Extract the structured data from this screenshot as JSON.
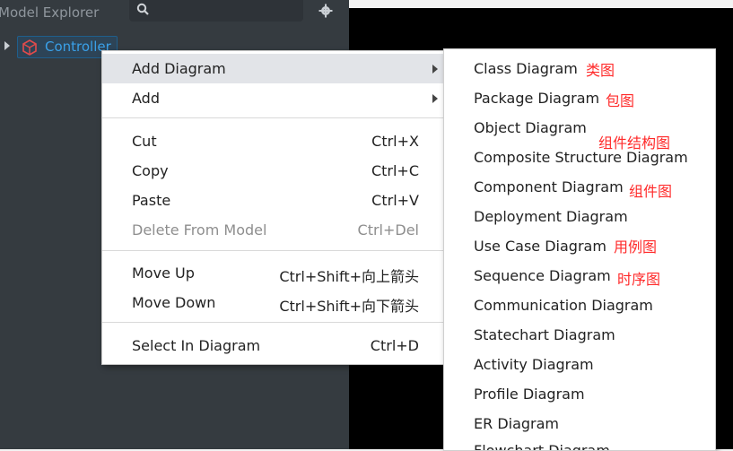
{
  "panel": {
    "title": "Model Explorer",
    "tree_node_label": "Controller"
  },
  "context_menu": {
    "items": [
      {
        "label": "Add Diagram",
        "shortcut": ""
      },
      {
        "label": "Add",
        "shortcut": ""
      },
      {
        "label": "Cut",
        "shortcut": "Ctrl+X"
      },
      {
        "label": "Copy",
        "shortcut": "Ctrl+C"
      },
      {
        "label": "Paste",
        "shortcut": "Ctrl+V"
      },
      {
        "label": "Delete From Model",
        "shortcut": "Ctrl+Del"
      },
      {
        "label": "Move Up",
        "shortcut": "Ctrl+Shift+向上箭头"
      },
      {
        "label": "Move Down",
        "shortcut": "Ctrl+Shift+向下箭头"
      },
      {
        "label": "Select In Diagram",
        "shortcut": "Ctrl+D"
      }
    ]
  },
  "submenu": {
    "items": [
      {
        "label": "Class Diagram"
      },
      {
        "label": "Package Diagram"
      },
      {
        "label": "Object Diagram"
      },
      {
        "label": "Composite Structure Diagram"
      },
      {
        "label": "Component Diagram"
      },
      {
        "label": "Deployment Diagram"
      },
      {
        "label": "Use Case Diagram"
      },
      {
        "label": "Sequence Diagram"
      },
      {
        "label": "Communication Diagram"
      },
      {
        "label": "Statechart Diagram"
      },
      {
        "label": "Activity Diagram"
      },
      {
        "label": "Profile Diagram"
      },
      {
        "label": "ER Diagram"
      },
      {
        "label": "Flowchart Diagram"
      }
    ]
  },
  "annotations": {
    "class": "类图",
    "package": "包图",
    "composite": "组件结构图",
    "component": "组件图",
    "use_case": "用例图",
    "sequence": "时序图"
  },
  "colors": {
    "panel_bg": "#353b40",
    "highlight": "#e2e4e8",
    "annotation": "#ff2a2a",
    "node_label": "#3aa0e8"
  }
}
